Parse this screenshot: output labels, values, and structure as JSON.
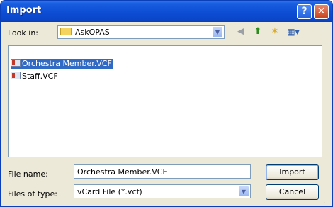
{
  "window": {
    "title": "Import"
  },
  "titlebar": {
    "help_label": "?",
    "close_label": "✕"
  },
  "lookin": {
    "label": "Look in:",
    "value": "AskOPAS",
    "icon": "folder-icon"
  },
  "toolbar": {
    "back_icon": "back-arrow-icon",
    "up_icon": "up-folder-icon",
    "new_folder_icon": "new-folder-icon",
    "views_icon": "views-menu-icon"
  },
  "files": [
    {
      "name": "Orchestra Member.VCF",
      "selected": true,
      "icon": "vcard-icon"
    },
    {
      "name": "Staff.VCF",
      "selected": false,
      "icon": "vcard-icon"
    }
  ],
  "filename": {
    "label": "File name:",
    "value": "Orchestra Member.VCF"
  },
  "filetype": {
    "label": "Files of type:",
    "value": "vCard File (*.vcf)"
  },
  "buttons": {
    "import": "Import",
    "cancel": "Cancel"
  },
  "colors": {
    "titlebar": "#0e4fd6",
    "selection": "#316ac5",
    "dialog_bg": "#ece9d8"
  }
}
